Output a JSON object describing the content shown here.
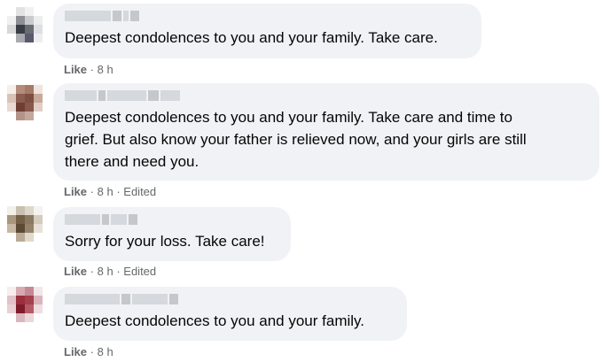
{
  "comments": [
    {
      "text": "Deepest condolences to you and your family. Take care.",
      "like_label": "Like",
      "separator": "·",
      "time": "8 h",
      "edited": ""
    },
    {
      "text": "Deepest condolences to you and your family. Take care and time to\ngrief. But also know your father is relieved now, and your girls are still\nthere and need you.",
      "like_label": "Like",
      "separator": "·",
      "time": "8 h",
      "edited": "Edited"
    },
    {
      "text": "Sorry for your loss. Take care!",
      "like_label": "Like",
      "separator": "·",
      "time": "8 h",
      "edited": "Edited"
    },
    {
      "text": "Deepest condolences to you and your family.",
      "like_label": "Like",
      "separator": "·",
      "time": "8 h",
      "edited": ""
    }
  ],
  "colors": {
    "bubble": "#f0f2f5",
    "text": "#050505",
    "meta": "#65676b"
  }
}
